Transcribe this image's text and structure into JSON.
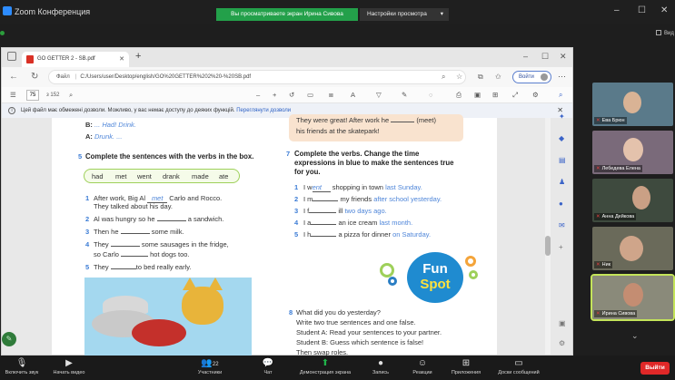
{
  "zoom": {
    "app_title": "Zoom Конференция",
    "share_banner": "Вы просматриваете экран Ирина Сивова",
    "view_options": "Настройки просмотра",
    "view_label": "Вид",
    "participants_count": "22",
    "toolbar": {
      "mute": "Включить звук",
      "video": "Начать видео",
      "participants": "Участники",
      "chat": "Чат",
      "share": "Демонстрация экрана",
      "record": "Запись",
      "reactions": "Реакции",
      "apps": "Приложения",
      "whiteboards": "Доски сообщений",
      "leave": "Выйти"
    },
    "participants": [
      {
        "name": "Ева Брюн"
      },
      {
        "name": "Лебедева Елена"
      },
      {
        "name": "Анна Дейкова"
      },
      {
        "name": "Ник"
      },
      {
        "name": "Ирина Сивова"
      }
    ]
  },
  "browser": {
    "tab_title": "GO GETTER 2 - SB.pdf",
    "url_prefix": "Файл",
    "url": "C:/Users/user/Desktop/english/GO%20GETTER%202%20-%20SB.pdf",
    "signin": "Войти",
    "page_number": "75",
    "page_count": "з 152",
    "info_message": "Цей файл має обмежені дозволи. Можливо, у вас немає доступу до деяких функцій.",
    "info_link": "Переглянути дозволи"
  },
  "book": {
    "prev_b": "B:",
    "prev_b_text": "... Had! Drink.",
    "prev_a": "A:",
    "prev_a_text": "Drunk. ...",
    "top_right_line1a": "They were great! After work he",
    "top_right_line1b": "(meet)",
    "top_right_line2": "his friends at the skatepark!",
    "ex5_num": "5",
    "ex5_title": "Complete the sentences with the verbs in the box.",
    "words": [
      "had",
      "met",
      "went",
      "drank",
      "made",
      "ate"
    ],
    "ex5_items": [
      {
        "n": "1",
        "a": "After work, Big Al",
        "ans": "met",
        "b": "Carlo and Rocco.",
        "c": "They talked about his day."
      },
      {
        "n": "2",
        "a": "Al was hungry so he",
        "b": "a sandwich."
      },
      {
        "n": "3",
        "a": "Then he",
        "b": "some milk."
      },
      {
        "n": "4",
        "a": "They",
        "b": "some sausages in the fridge,",
        "c": "so Carlo",
        "d": "hot dogs too."
      },
      {
        "n": "5",
        "a": "They",
        "b": "to bed really early."
      }
    ],
    "ex7_num": "7",
    "ex7_title1": "Complete the verbs. Change the time",
    "ex7_title2": "expressions in blue to make the sentences true",
    "ex7_title3": "for you.",
    "ex7_items": [
      {
        "n": "1",
        "a": "I w",
        "ans": "ent",
        "b": "shopping in town",
        "hl": "last Sunday."
      },
      {
        "n": "2",
        "a": "I m",
        "b": "my friends",
        "hl": "after school yesterday."
      },
      {
        "n": "3",
        "a": "I f",
        "b": "ill",
        "hl": "two days ago."
      },
      {
        "n": "4",
        "a": "I a",
        "b": "an ice cream",
        "hl": "last month."
      },
      {
        "n": "5",
        "a": "I h",
        "b": "a pizza for dinner",
        "hl": "on Saturday."
      }
    ],
    "fun1": "Fun",
    "fun2": "Spot",
    "ex8_num": "8",
    "ex8_lines": [
      "What did you do yesterday?",
      "Write two true sentences and one false.",
      "Student A: Read your sentences to your partner.",
      "Student B: Guess which sentence is false!",
      "Then swap roles."
    ]
  }
}
